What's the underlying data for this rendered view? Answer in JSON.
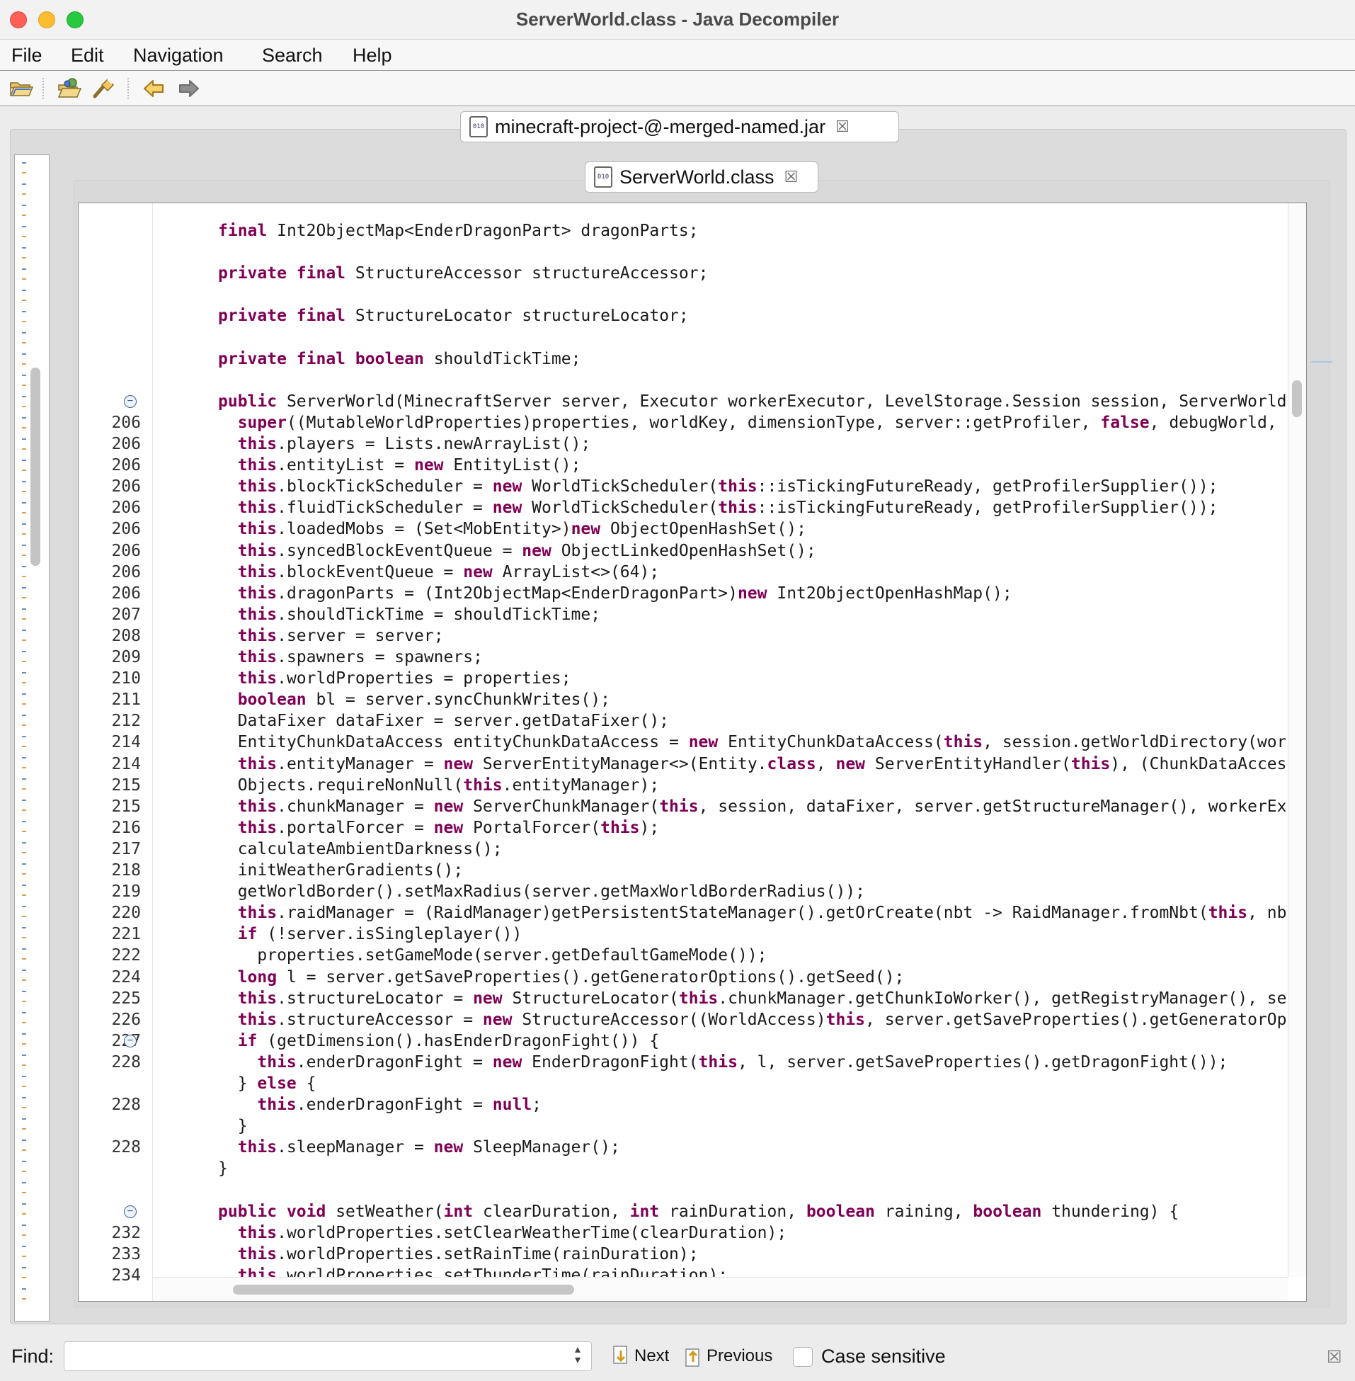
{
  "window": {
    "title": "ServerWorld.class - Java Decompiler"
  },
  "menu": [
    "File",
    "Edit",
    "Navigation",
    "Search",
    "Help"
  ],
  "toolbar": {
    "buttons": [
      {
        "icon": "open-folder-icon",
        "label": "Open"
      },
      {
        "icon": "open-type-icon",
        "label": "Open Type"
      },
      {
        "icon": "search-flashlight-icon",
        "label": "Search"
      },
      {
        "icon": "back-arrow-icon",
        "label": "Back"
      },
      {
        "icon": "forward-arrow-icon",
        "label": "Forward"
      }
    ]
  },
  "tabs": {
    "archive": {
      "label": "minecraft-project-@-merged-named.jar",
      "icon": "jar-file-icon",
      "icon_text": "010"
    },
    "file": {
      "label": "ServerWorld.class",
      "icon": "class-file-icon",
      "icon_text": "010"
    }
  },
  "code": {
    "lines": [
      {
        "n": "",
        "fold": false,
        "text": "final Int2ObjectMap<EnderDragonPart> dragonParts;"
      },
      {
        "n": "",
        "fold": false,
        "text": ""
      },
      {
        "n": "",
        "fold": false,
        "text": "private final StructureAccessor structureAccessor;"
      },
      {
        "n": "",
        "fold": false,
        "text": ""
      },
      {
        "n": "",
        "fold": false,
        "text": "private final StructureLocator structureLocator;"
      },
      {
        "n": "",
        "fold": false,
        "text": ""
      },
      {
        "n": "",
        "fold": false,
        "text": "private final boolean shouldTickTime;"
      },
      {
        "n": "",
        "fold": false,
        "text": ""
      },
      {
        "n": "",
        "fold": true,
        "text": "public ServerWorld(MinecraftServer server, Executor workerExecutor, LevelStorage.Session session, ServerWorldPro"
      },
      {
        "n": "206",
        "fold": false,
        "text": "  super((MutableWorldProperties)properties, worldKey, dimensionType, server::getProfiler, false, debugWorld, see"
      },
      {
        "n": "206",
        "fold": false,
        "text": "  this.players = Lists.newArrayList();"
      },
      {
        "n": "206",
        "fold": false,
        "text": "  this.entityList = new EntityList();"
      },
      {
        "n": "206",
        "fold": false,
        "text": "  this.blockTickScheduler = new WorldTickScheduler(this::isTickingFutureReady, getProfilerSupplier());"
      },
      {
        "n": "206",
        "fold": false,
        "text": "  this.fluidTickScheduler = new WorldTickScheduler(this::isTickingFutureReady, getProfilerSupplier());"
      },
      {
        "n": "206",
        "fold": false,
        "text": "  this.loadedMobs = (Set<MobEntity>)new ObjectOpenHashSet();"
      },
      {
        "n": "206",
        "fold": false,
        "text": "  this.syncedBlockEventQueue = new ObjectLinkedOpenHashSet();"
      },
      {
        "n": "206",
        "fold": false,
        "text": "  this.blockEventQueue = new ArrayList<>(64);"
      },
      {
        "n": "206",
        "fold": false,
        "text": "  this.dragonParts = (Int2ObjectMap<EnderDragonPart>)new Int2ObjectOpenHashMap();"
      },
      {
        "n": "207",
        "fold": false,
        "text": "  this.shouldTickTime = shouldTickTime;"
      },
      {
        "n": "208",
        "fold": false,
        "text": "  this.server = server;"
      },
      {
        "n": "209",
        "fold": false,
        "text": "  this.spawners = spawners;"
      },
      {
        "n": "210",
        "fold": false,
        "text": "  this.worldProperties = properties;"
      },
      {
        "n": "211",
        "fold": false,
        "text": "  boolean bl = server.syncChunkWrites();"
      },
      {
        "n": "212",
        "fold": false,
        "text": "  DataFixer dataFixer = server.getDataFixer();"
      },
      {
        "n": "214",
        "fold": false,
        "text": "  EntityChunkDataAccess entityChunkDataAccess = new EntityChunkDataAccess(this, session.getWorldDirectory(worldK"
      },
      {
        "n": "214",
        "fold": false,
        "text": "  this.entityManager = new ServerEntityManager<>(Entity.class, new ServerEntityHandler(this), (ChunkDataAccess<E"
      },
      {
        "n": "215",
        "fold": false,
        "text": "  Objects.requireNonNull(this.entityManager);"
      },
      {
        "n": "215",
        "fold": false,
        "text": "  this.chunkManager = new ServerChunkManager(this, session, dataFixer, server.getStructureManager(), workerExecu"
      },
      {
        "n": "216",
        "fold": false,
        "text": "  this.portalForcer = new PortalForcer(this);"
      },
      {
        "n": "217",
        "fold": false,
        "text": "  calculateAmbientDarkness();"
      },
      {
        "n": "218",
        "fold": false,
        "text": "  initWeatherGradients();"
      },
      {
        "n": "219",
        "fold": false,
        "text": "  getWorldBorder().setMaxRadius(server.getMaxWorldBorderRadius());"
      },
      {
        "n": "220",
        "fold": false,
        "text": "  this.raidManager = (RaidManager)getPersistentStateManager().getOrCreate(nbt -> RaidManager.fromNbt(this, nbt),"
      },
      {
        "n": "221",
        "fold": false,
        "text": "  if (!server.isSingleplayer())"
      },
      {
        "n": "222",
        "fold": false,
        "text": "    properties.setGameMode(server.getDefaultGameMode());"
      },
      {
        "n": "224",
        "fold": false,
        "text": "  long l = server.getSaveProperties().getGeneratorOptions().getSeed();"
      },
      {
        "n": "225",
        "fold": false,
        "text": "  this.structureLocator = new StructureLocator(this.chunkManager.getChunkIoWorker(), getRegistryManager(), serve"
      },
      {
        "n": "226",
        "fold": false,
        "text": "  this.structureAccessor = new StructureAccessor((WorldAccess)this, server.getSaveProperties().getGeneratorOptio"
      },
      {
        "n": "227",
        "fold": true,
        "text": "  if (getDimension().hasEnderDragonFight()) {"
      },
      {
        "n": "228",
        "fold": false,
        "text": "    this.enderDragonFight = new EnderDragonFight(this, l, server.getSaveProperties().getDragonFight());"
      },
      {
        "n": "",
        "fold": false,
        "text": "  } else {"
      },
      {
        "n": "228",
        "fold": false,
        "text": "    this.enderDragonFight = null;"
      },
      {
        "n": "",
        "fold": false,
        "text": "  }"
      },
      {
        "n": "228",
        "fold": false,
        "text": "  this.sleepManager = new SleepManager();"
      },
      {
        "n": "",
        "fold": false,
        "text": "}"
      },
      {
        "n": "",
        "fold": false,
        "text": ""
      },
      {
        "n": "",
        "fold": true,
        "text": "public void setWeather(int clearDuration, int rainDuration, boolean raining, boolean thundering) {"
      },
      {
        "n": "232",
        "fold": false,
        "text": "  this.worldProperties.setClearWeatherTime(clearDuration);"
      },
      {
        "n": "233",
        "fold": false,
        "text": "  this.worldProperties.setRainTime(rainDuration);"
      },
      {
        "n": "234",
        "fold": false,
        "text": "  this.worldProperties.setThunderTime(rainDuration);"
      }
    ],
    "keywords": [
      "final",
      "private",
      "public",
      "boolean",
      "super",
      "this",
      "new",
      "false",
      "class",
      "if",
      "long",
      "else",
      "null",
      "void",
      "int"
    ],
    "keyword_color": "#7f0055"
  },
  "find": {
    "label": "Find:",
    "value": "",
    "placeholder": "",
    "next_label": "Next",
    "previous_label": "Previous",
    "case_sensitive_label": "Case sensitive",
    "case_sensitive_checked": false
  }
}
